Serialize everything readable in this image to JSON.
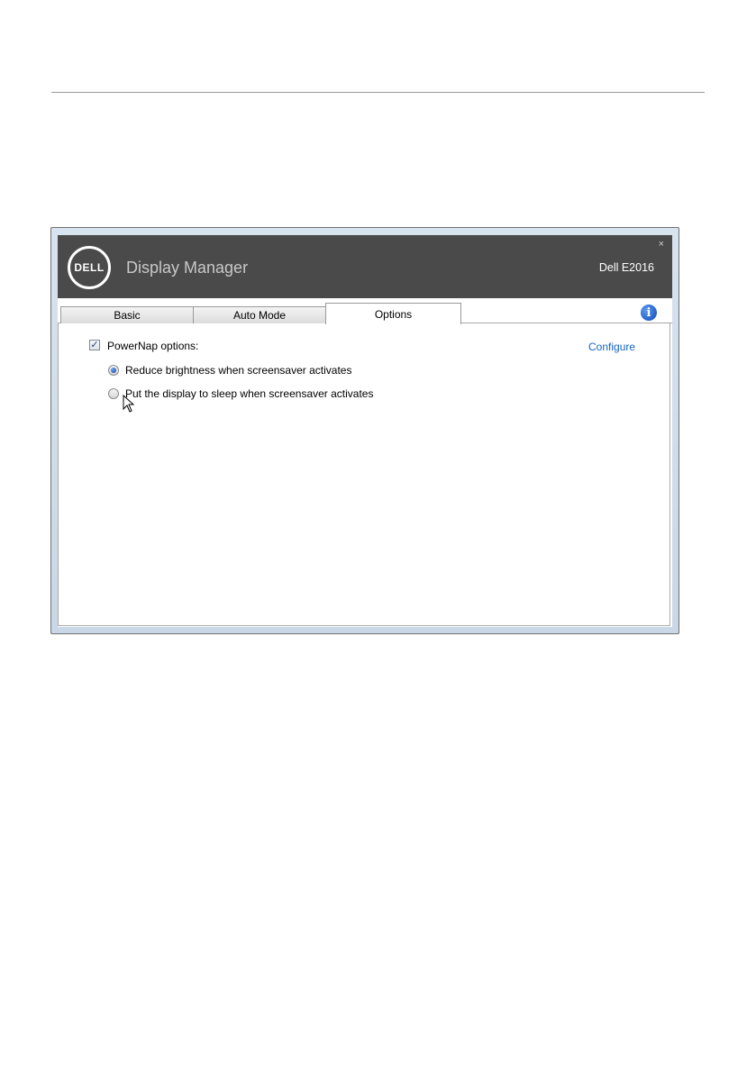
{
  "window": {
    "logo_text": "DELL",
    "title": "Display Manager",
    "monitor": "Dell E2016",
    "close_glyph": "×"
  },
  "tabs": [
    {
      "label": "Basic",
      "active": false
    },
    {
      "label": "Auto Mode",
      "active": false
    },
    {
      "label": "Options",
      "active": true
    }
  ],
  "options": {
    "powernap_label": "PowerNap options:",
    "powernap_checked": true,
    "configure_label": "Configure",
    "radio_options": [
      {
        "label": "Reduce brightness when screensaver activates",
        "selected": true
      },
      {
        "label": "Put the display to sleep when screensaver activates",
        "selected": false
      }
    ]
  },
  "icons": {
    "info": "info-icon",
    "close": "close-icon",
    "cursor": "mouse-pointer-icon"
  },
  "colors": {
    "title_bar": "#4a4a4a",
    "link": "#1565c0",
    "window_frame": "#c9d7e6"
  }
}
